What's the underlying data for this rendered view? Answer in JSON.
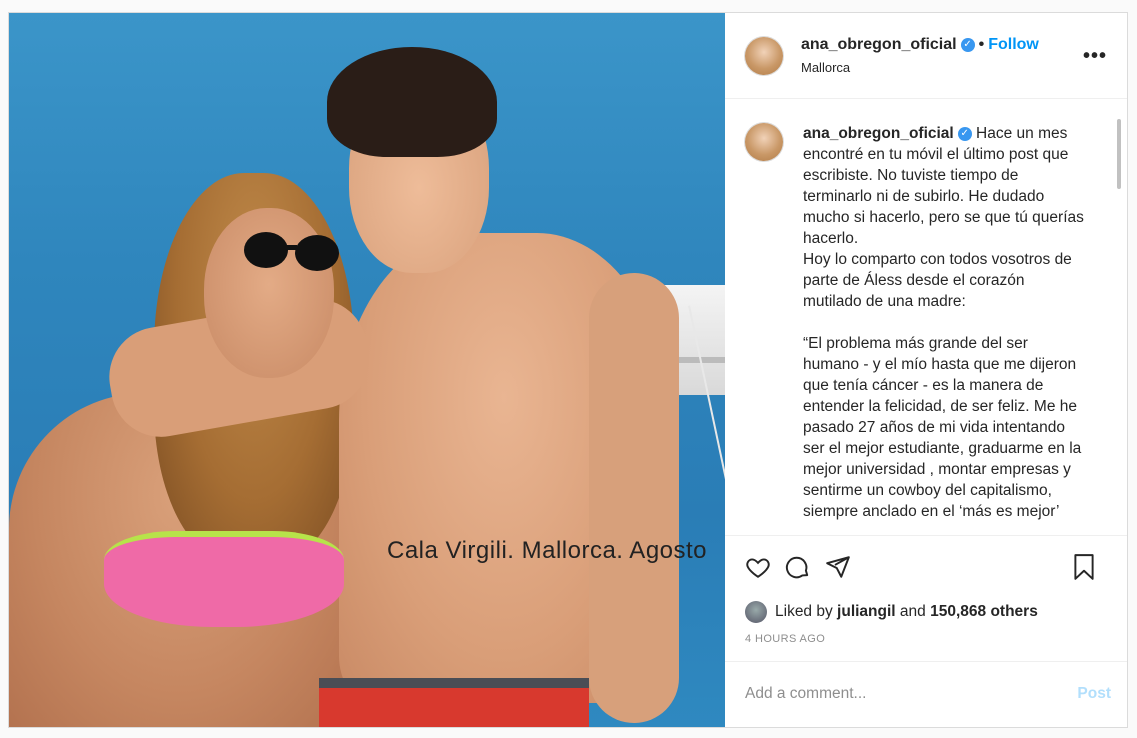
{
  "photo": {
    "caption": "Cala Virgili. Mallorca. Agosto"
  },
  "header": {
    "username": "ana_obregon_oficial",
    "verified_mark": "✓",
    "separator": "•",
    "follow_label": "Follow",
    "location": "Mallorca",
    "more_icon": "more-options-icon"
  },
  "comment": {
    "username": "ana_obregon_oficial",
    "text": "Hace un mes encontré en tu móvil el último post que escribiste. No tuviste tiempo de terminarlo ni de subirlo. He dudado mucho si hacerlo, pero se que tú querías hacerlo.\nHoy lo comparto con todos vosotros de parte de Áless desde el corazón mutilado de una madre:\n\n“El problema más grande del ser humano - y el mío hasta que me dijeron que tenía cáncer - es la manera de entender la felicidad, de ser feliz. Me he pasado 27 años de mi vida intentando ser el mejor estudiante, graduarme en la mejor universidad , montar empresas y sentirme un cowboy del capitalismo, siempre anclado en el ‘más es mejor’"
  },
  "likes": {
    "prefix": "Liked by ",
    "user": "juliangil",
    "middle": " and ",
    "count": "150,868 others"
  },
  "timestamp": "4 HOURS AGO",
  "add_comment": {
    "placeholder": "Add a comment...",
    "post_label": "Post"
  }
}
